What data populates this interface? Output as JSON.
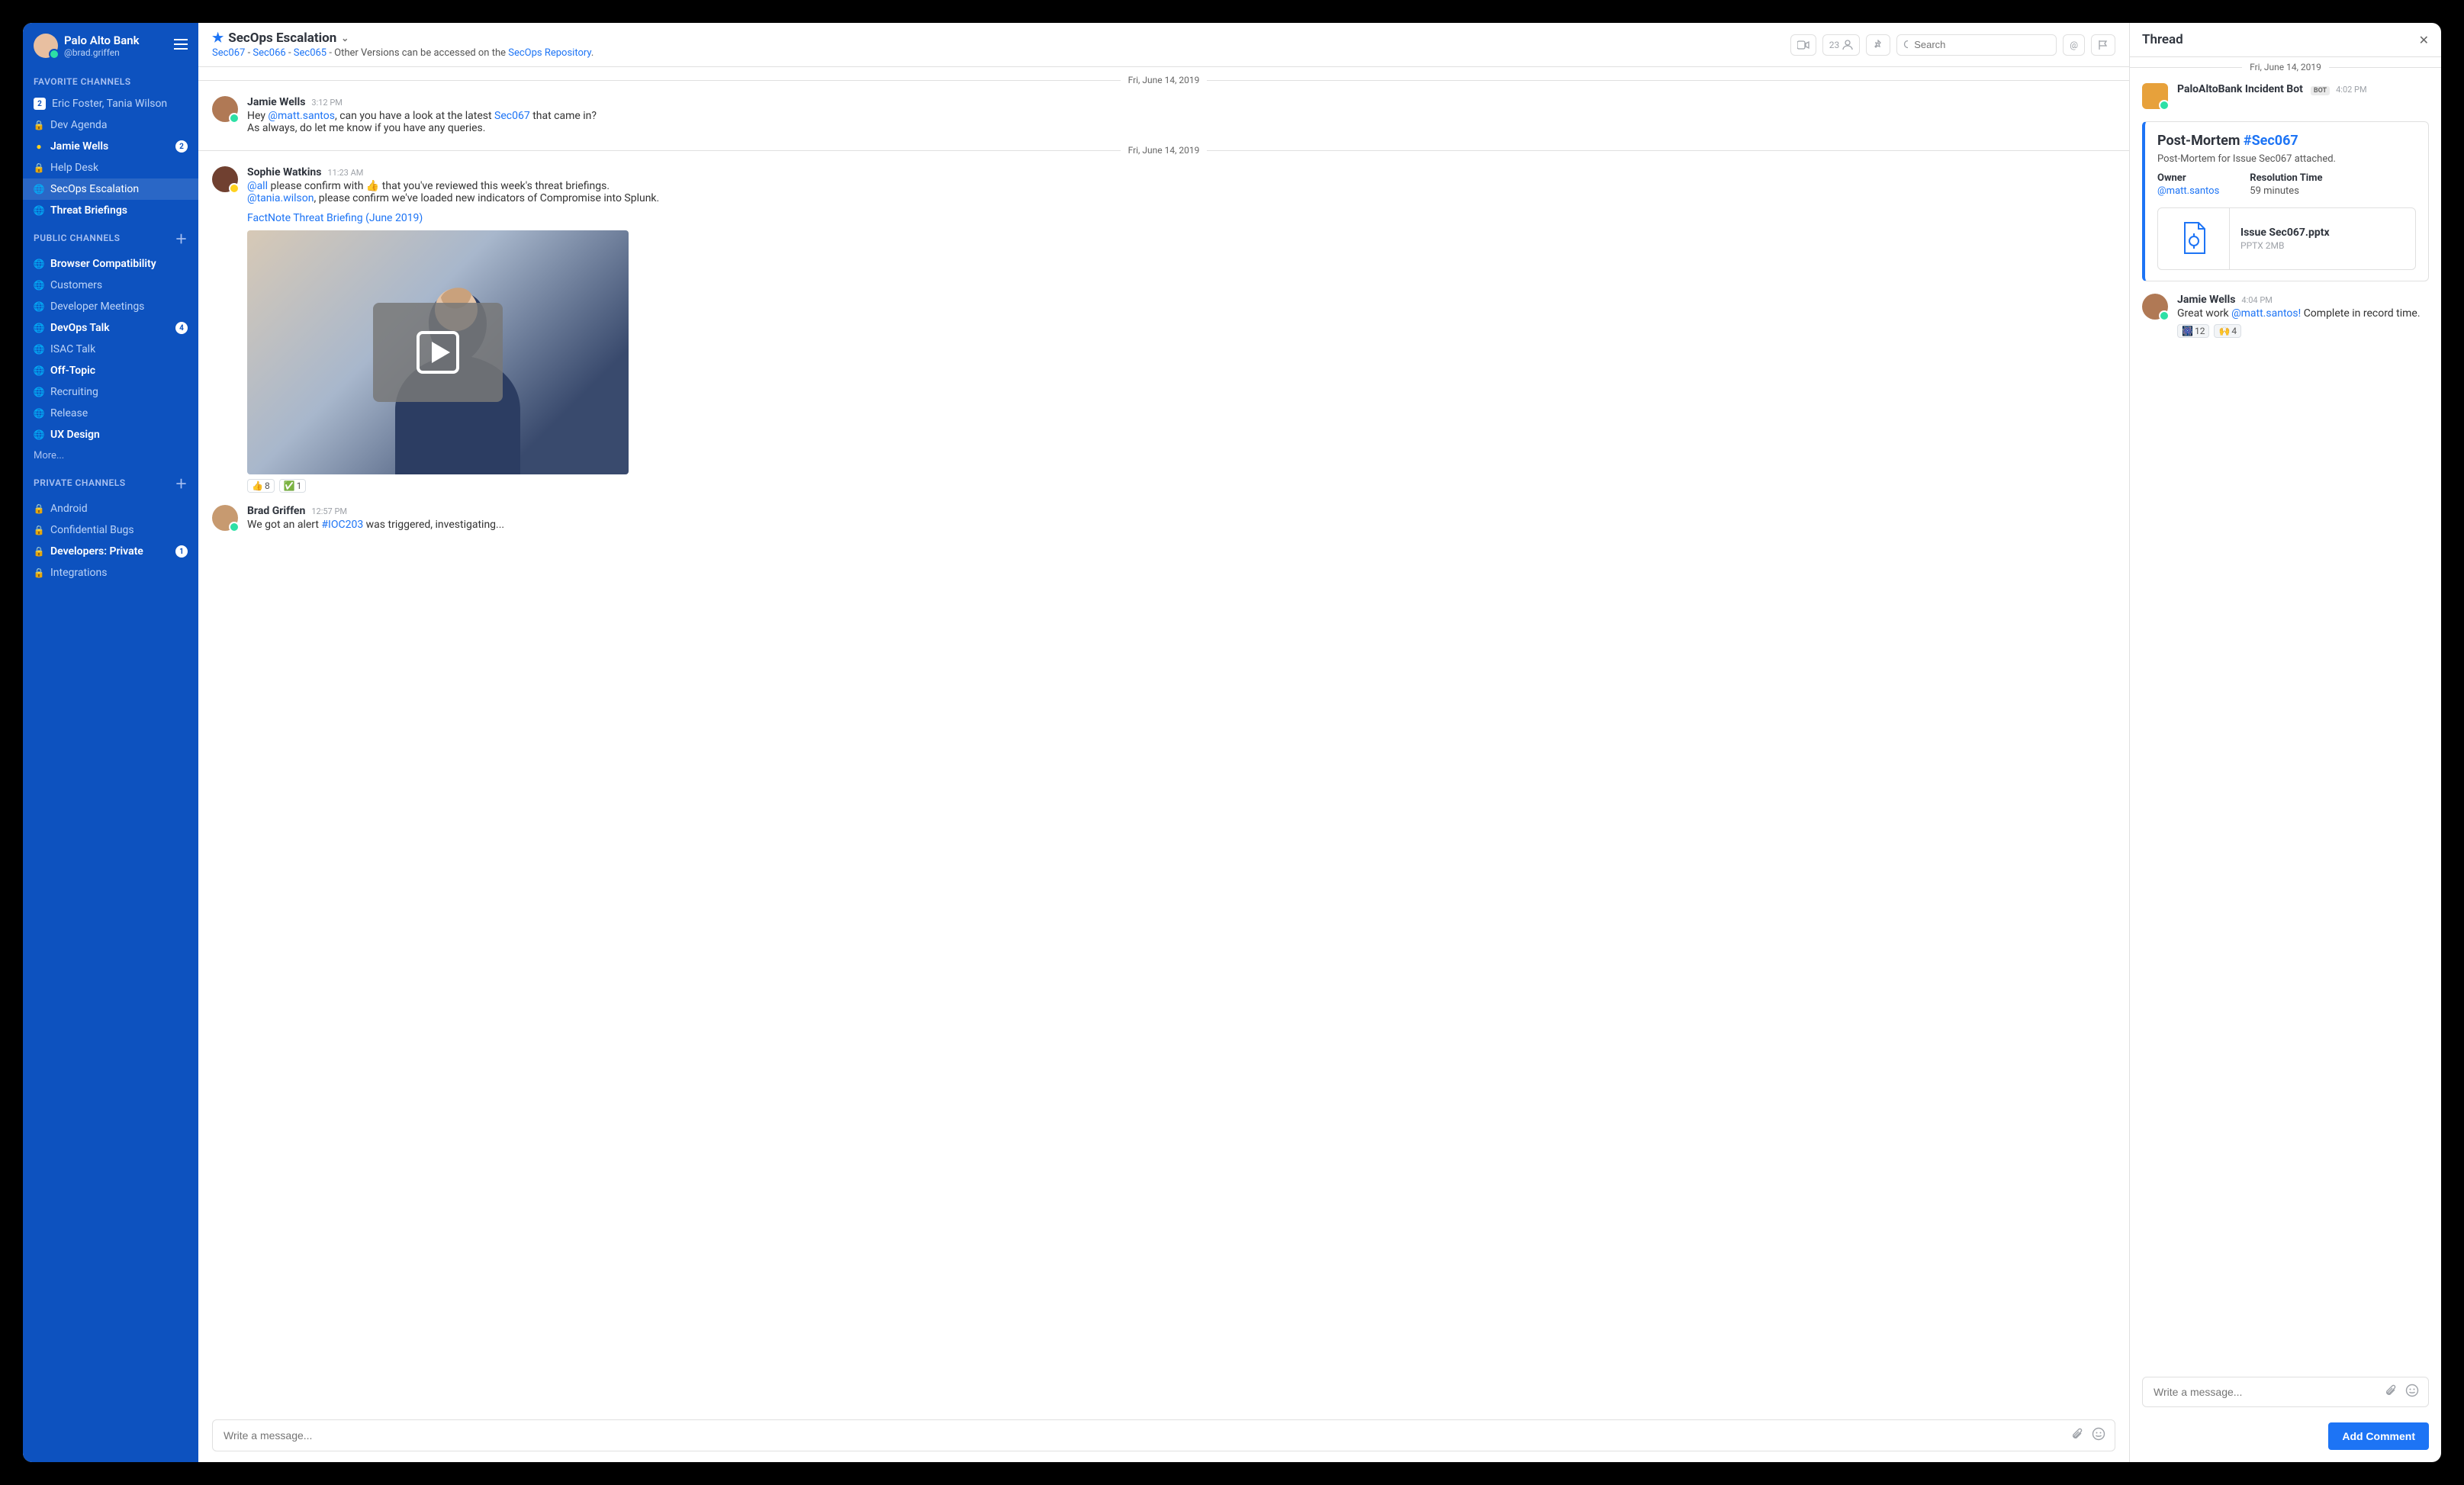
{
  "workspace": {
    "org": "Palo Alto Bank",
    "handle": "@brad.griffen"
  },
  "sidebar": {
    "sections": {
      "favorites": {
        "title": "Favorite Channels"
      },
      "public": {
        "title": "Public Channels"
      },
      "private": {
        "title": "Private Channels"
      }
    },
    "favorites": [
      {
        "name": "Eric Foster, Tania Wilson",
        "icon": "people",
        "badge": "2",
        "badgeSquare": true
      },
      {
        "name": "Dev Agenda",
        "icon": "lock"
      },
      {
        "name": "Jamie Wells",
        "icon": "user",
        "unread": true,
        "badge": "2"
      },
      {
        "name": "Help Desk",
        "icon": "lock"
      },
      {
        "name": "SecOps Escalation",
        "icon": "globe",
        "active": true
      },
      {
        "name": "Threat Briefings",
        "icon": "globe",
        "unread": true
      }
    ],
    "public": [
      {
        "name": "Browser Compatibility",
        "unread": true
      },
      {
        "name": "Customers"
      },
      {
        "name": "Developer Meetings"
      },
      {
        "name": "DevOps Talk",
        "unread": true,
        "badge": "4"
      },
      {
        "name": "ISAC Talk"
      },
      {
        "name": "Off-Topic",
        "unread": true
      },
      {
        "name": "Recruiting"
      },
      {
        "name": "Release"
      },
      {
        "name": "UX Design",
        "unread": true
      }
    ],
    "more": "More...",
    "private": [
      {
        "name": "Android"
      },
      {
        "name": "Confidential Bugs"
      },
      {
        "name": "Developers: Private",
        "unread": true,
        "badge": "1"
      },
      {
        "name": "Integrations"
      }
    ]
  },
  "header": {
    "channel": "SecOps Escalation",
    "subtitle_links": [
      "Sec067",
      "Sec066",
      "Sec065"
    ],
    "subtitle_sep": " - ",
    "subtitle_text": "Other Versions can be accessed on the ",
    "subtitle_repo": "SecOps Repository",
    "subtitle_end": ".",
    "members": "23",
    "search_placeholder": "Search"
  },
  "dates": {
    "d1": "Fri, June 14, 2019",
    "d2": "Fri, June 14, 2019",
    "d3": "Fri, June 14, 2019"
  },
  "messages": {
    "m1": {
      "author": "Jamie Wells",
      "time": "3:12 PM",
      "l1a": "Hey ",
      "l1b": "@matt.santos",
      "l1c": ", can you have a look at the latest ",
      "l1d": "Sec067",
      "l1e": " that came in?",
      "l2": "As always, do let me know if you have any queries."
    },
    "m2": {
      "author": "Sophie Watkins",
      "time": "11:23 AM",
      "l1a": "@all",
      "l1b": " please confirm with 👍 that you've reviewed this week's threat briefings.",
      "l2a": "@tania.wilson",
      "l2b": ", please confirm we've loaded new indicators of Compromise into Splunk.",
      "link": "FactNote Threat Briefing (June 2019)",
      "r1": "👍",
      "r1c": "8",
      "r2": "✅",
      "r2c": "1"
    },
    "m3": {
      "author": "Brad Griffen",
      "time": "12:57 PM",
      "l1a": "We got an alert ",
      "l1b": "#IOC203",
      "l1c": " was triggered, investigating..."
    }
  },
  "composer": {
    "placeholder": "Write a message..."
  },
  "thread": {
    "title": "Thread",
    "bot": {
      "author": "PaloAltoBank Incident Bot",
      "tag": "BOT",
      "time": "4:02 PM"
    },
    "card": {
      "title": "Post-Mortem ",
      "hash": "#Sec067",
      "desc": "Post-Mortem for Issue Sec067 attached.",
      "owner_lbl": "Owner",
      "owner": "@matt.santos",
      "res_lbl": "Resolution Time",
      "res": "59 minutes",
      "file": "Issue Sec067.pptx",
      "file_meta": "PPTX 2MB"
    },
    "reply": {
      "author": "Jamie Wells",
      "time": "4:04 PM",
      "l1a": "Great work ",
      "l1b": "@matt.santos!",
      "l1c": " Complete in record time.",
      "r1": "🎆",
      "r1c": "12",
      "r2": "🙌",
      "r2c": "4"
    },
    "placeholder": "Write a message...",
    "button": "Add Comment"
  }
}
